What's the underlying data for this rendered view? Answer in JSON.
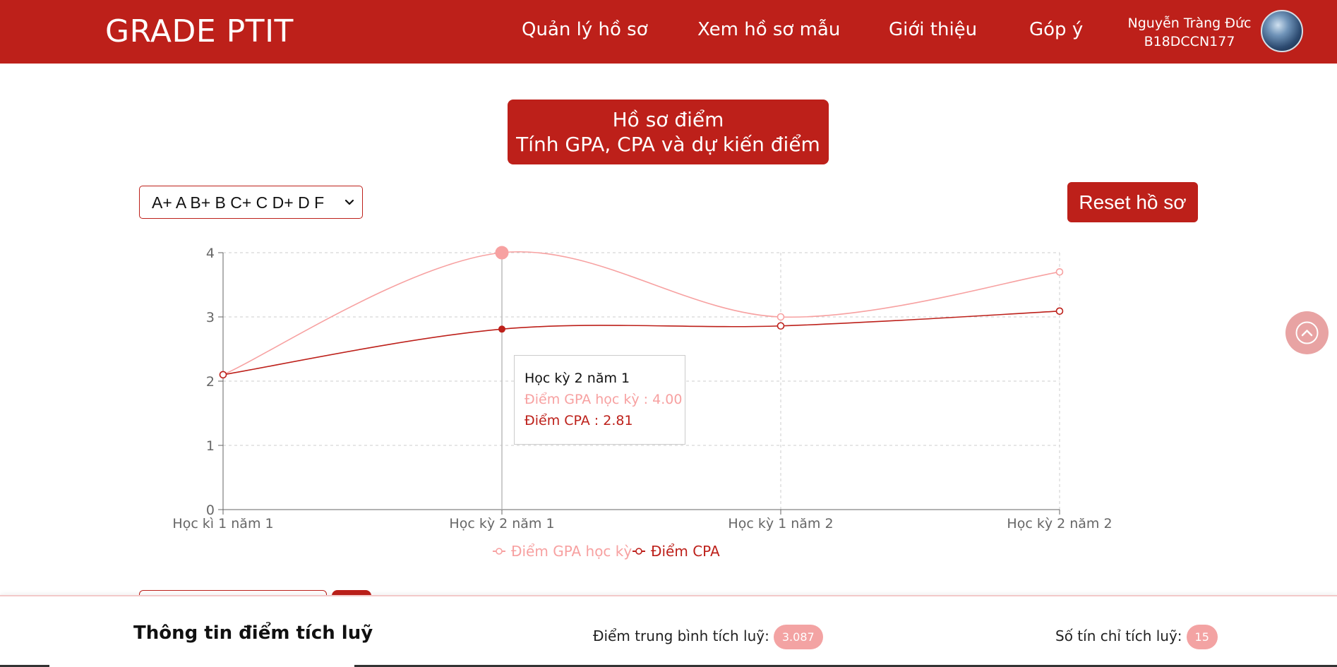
{
  "header": {
    "brand": "GRADE PTIT",
    "nav": [
      "Quản lý hồ sơ",
      "Xem hồ sơ mẫu",
      "Giới thiệu",
      "Góp ý"
    ],
    "user_name": "Nguyễn Tràng Đức",
    "user_id": "B18DCCN177"
  },
  "title": {
    "line1": "Hồ sơ điểm",
    "line2": "Tính GPA, CPA và dự kiến điểm"
  },
  "grade_select": {
    "selected": "A+ A B+ B C+ C D+ D F"
  },
  "reset_label": "Reset hồ sơ",
  "tooltip": {
    "title": "Học kỳ 2 năm 1",
    "gpa_text": "Điểm GPA học kỳ : 4.00",
    "cpa_text": "Điểm CPA : 2.81"
  },
  "chart_data": {
    "type": "line",
    "categories": [
      "Học kì 1 năm 1",
      "Học kỳ 2 năm 1",
      "Học kỳ 1 năm 2",
      "Học kỳ 2 năm 2"
    ],
    "series": [
      {
        "name": "Điểm GPA học kỳ",
        "values": [
          2.1,
          4.0,
          3.0,
          3.7
        ],
        "color": "#f7a1a1"
      },
      {
        "name": "Điểm CPA",
        "values": [
          2.1,
          2.81,
          2.86,
          3.09
        ],
        "color": "#bd201a"
      }
    ],
    "yticks": [
      0,
      1,
      2,
      3,
      4
    ],
    "ylim": [
      0,
      4
    ],
    "grid": true,
    "legend": "bottom",
    "active_category": "Học kỳ 2 năm 1"
  },
  "footer": {
    "title": "Thông tin điểm tích luỹ",
    "avg_label": "Điểm trung bình tích luỹ:",
    "avg_value": "3.087",
    "credits_label": "Số tín chỉ tích luỹ:",
    "credits_value": "15"
  },
  "colors": {
    "primary": "#bd201a",
    "accent_light": "#f7a1a1"
  }
}
